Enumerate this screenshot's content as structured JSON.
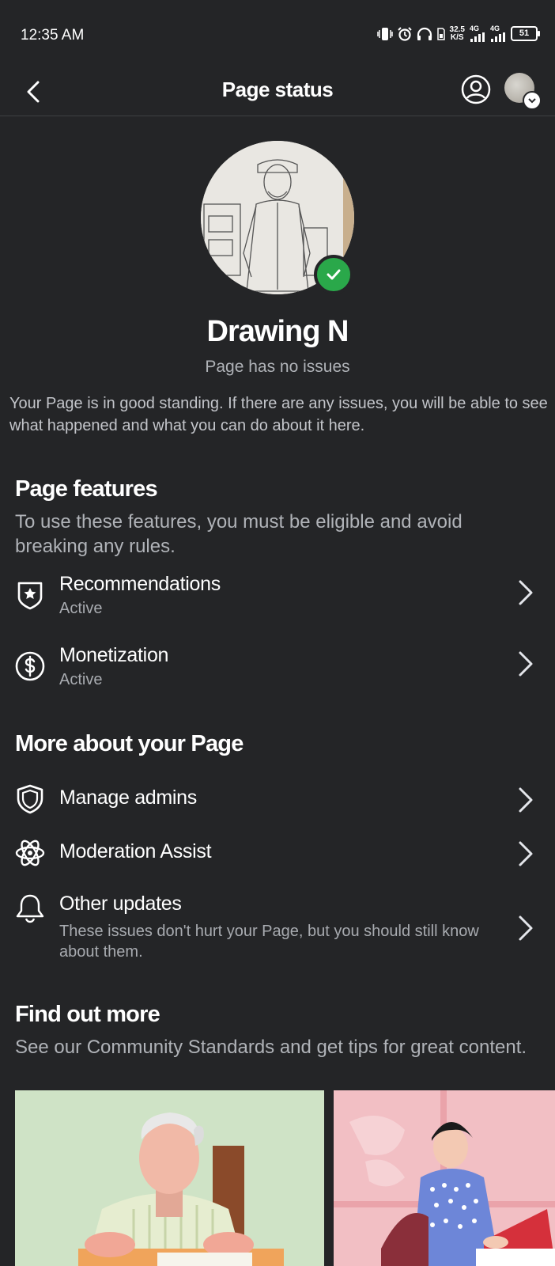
{
  "status_bar": {
    "time": "12:35 AM",
    "net_speed_value": "32.5",
    "net_speed_unit": "K/S",
    "signal1_label": "4G",
    "signal2_label": "4G",
    "battery": "51",
    "icons": [
      "vibrate-icon",
      "alarm-icon",
      "headphones-icon",
      "signal-icon",
      "battery-icon"
    ]
  },
  "app_bar": {
    "title": "Page status"
  },
  "profile": {
    "name": "Drawing N",
    "status": "Page has no issues",
    "description": "Your Page is in good standing. If there are any issues, you will be able to see what happened and what you can do about it here."
  },
  "page_features": {
    "title": "Page features",
    "subtitle": "To use these features, you must be eligible and avoid breaking any rules.",
    "items": [
      {
        "label": "Recommendations",
        "status": "Active",
        "icon": "shield-star-icon"
      },
      {
        "label": "Monetization",
        "status": "Active",
        "icon": "dollar-circle-icon"
      }
    ]
  },
  "more_about": {
    "title": "More about your Page",
    "items": [
      {
        "label": "Manage admins",
        "icon": "shield-icon"
      },
      {
        "label": "Moderation Assist",
        "icon": "atom-icon"
      },
      {
        "label": "Other updates",
        "description": "These issues don't hurt your Page, but you should still know about them.",
        "icon": "bell-icon"
      }
    ]
  },
  "find_out_more": {
    "title": "Find out more",
    "subtitle": "See our Community Standards and get tips for great content."
  },
  "colors": {
    "background": "#242527",
    "text_primary": "#ffffff",
    "text_secondary": "#b0b3b8",
    "success": "#2aa84a"
  }
}
